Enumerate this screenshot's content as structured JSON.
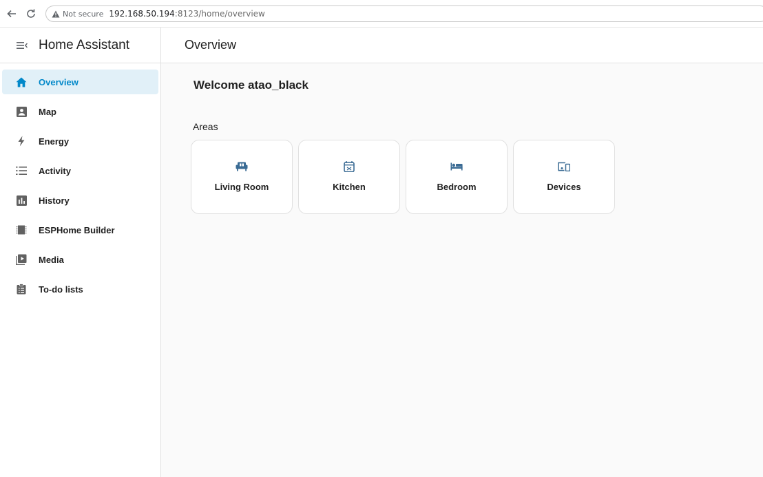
{
  "browser": {
    "not_secure_label": "Not secure",
    "url_host": "192.168.50.194",
    "url_path": ":8123/home/overview"
  },
  "app": {
    "title": "Home Assistant",
    "accent_color": "#0288c9"
  },
  "sidebar": {
    "items": [
      {
        "label": "Overview",
        "icon": "home-icon",
        "active": true
      },
      {
        "label": "Map",
        "icon": "account-box-icon",
        "active": false
      },
      {
        "label": "Energy",
        "icon": "lightning-icon",
        "active": false
      },
      {
        "label": "Activity",
        "icon": "list-icon",
        "active": false
      },
      {
        "label": "History",
        "icon": "bar-chart-icon",
        "active": false
      },
      {
        "label": "ESPHome Builder",
        "icon": "chip-icon",
        "active": false
      },
      {
        "label": "Media",
        "icon": "play-box-icon",
        "active": false
      },
      {
        "label": "To-do lists",
        "icon": "clipboard-list-icon",
        "active": false
      }
    ]
  },
  "main": {
    "page_title": "Overview",
    "welcome": "Welcome atao_black",
    "areas_heading": "Areas",
    "areas": [
      {
        "name": "Living Room",
        "icon": "sofa-icon"
      },
      {
        "name": "Kitchen",
        "icon": "stove-icon"
      },
      {
        "name": "Bedroom",
        "icon": "bed-icon"
      },
      {
        "name": "Devices",
        "icon": "devices-icon"
      }
    ]
  }
}
